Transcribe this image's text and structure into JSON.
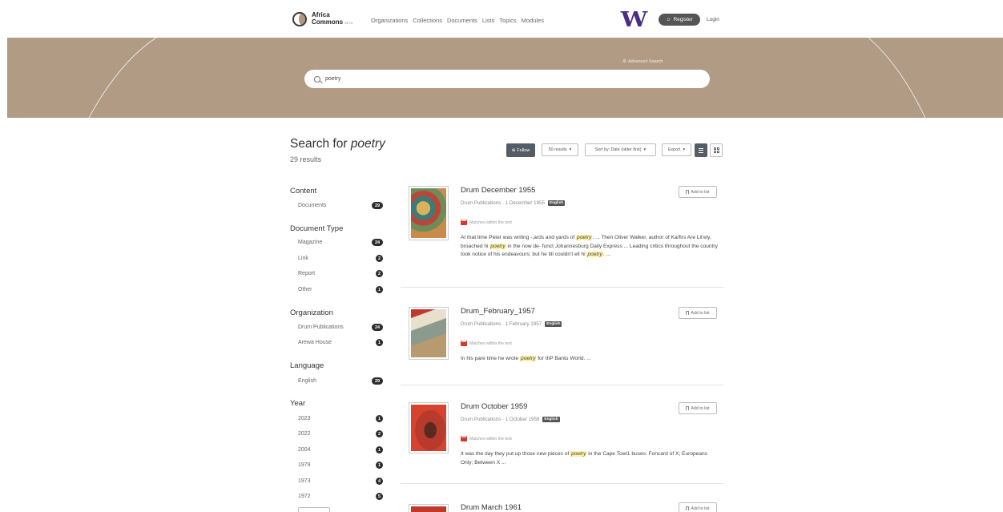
{
  "brand": {
    "name_line1": "Africa",
    "name_line2": "Commons",
    "beta": "BETA"
  },
  "nav": [
    "Organizations",
    "Collections",
    "Documents",
    "Lists",
    "Topics",
    "Modules"
  ],
  "header": {
    "uw_logo": "W",
    "register": "Register",
    "login": "Login",
    "accent_color": "#4b2e83"
  },
  "hero": {
    "advanced_search": "Advanced Search",
    "search_value": "poetry",
    "bg_color": "#b19b85"
  },
  "results_header": {
    "prefix": "Search for ",
    "query": "poetry",
    "count": "29 results"
  },
  "toolbar": {
    "follow": "Follow",
    "per_page": "50 results",
    "sort": "Sort by: Date (older first)",
    "export": "Export"
  },
  "facets": {
    "content": {
      "title": "Content",
      "items": [
        {
          "label": "Documents",
          "count": "29"
        }
      ]
    },
    "doc_type": {
      "title": "Document Type",
      "items": [
        {
          "label": "Magazine",
          "count": "24"
        },
        {
          "label": "Link",
          "count": "2"
        },
        {
          "label": "Report",
          "count": "2"
        },
        {
          "label": "Other",
          "count": "1"
        }
      ]
    },
    "organization": {
      "title": "Organization",
      "items": [
        {
          "label": "Drum Publications",
          "count": "24"
        },
        {
          "label": "Arewa House",
          "count": "1"
        }
      ]
    },
    "language": {
      "title": "Language",
      "items": [
        {
          "label": "English",
          "count": "29"
        }
      ]
    },
    "year": {
      "title": "Year",
      "items": [
        {
          "label": "2023",
          "count": "1"
        },
        {
          "label": "2022",
          "count": "2"
        },
        {
          "label": "2004",
          "count": "1"
        },
        {
          "label": "1979",
          "count": "1"
        },
        {
          "label": "1973",
          "count": "4"
        },
        {
          "label": "1972",
          "count": "5"
        }
      ]
    }
  },
  "results": [
    {
      "title": "Drum December 1955",
      "meta": "Drum Publications · 1 December 1955",
      "lang": "English",
      "matches_label": "Matches within the text",
      "snippet": [
        "At that time Peter was writing -,ards and yards of ",
        "poetry",
        ". ... Then Oliver Walker, author of Ka/firs Are Lit'ely, broached hi ",
        "poetry",
        " in the now de- funct Johannesburg Daily Express ... Leading critics throughout the country took notice of his endeavours; but he till couldn't ell hi ",
        "poetry",
        ". ..."
      ],
      "add_to_list": "Add to list"
    },
    {
      "title": "Drum_February_1957",
      "meta": "Drum Publications · 1 February 1957",
      "lang": "English",
      "matches_label": "Matches within the text",
      "snippet": [
        "In his pare time he wrote ",
        "poetry",
        " for thP Bantu World. ..."
      ],
      "add_to_list": "Add to list"
    },
    {
      "title": "Drum October 1959",
      "meta": "Drum Publications · 1 October 1959",
      "lang": "English",
      "matches_label": "Matches within the text",
      "snippet": [
        "It was the day they put up those new pieces of ",
        "poetry",
        " in the Cape Towi1 buses: Foncard of X; Europeans Only; Between X ..."
      ],
      "add_to_list": "Add to list"
    },
    {
      "title": "Drum March 1961",
      "add_to_list": "Add to list"
    }
  ]
}
